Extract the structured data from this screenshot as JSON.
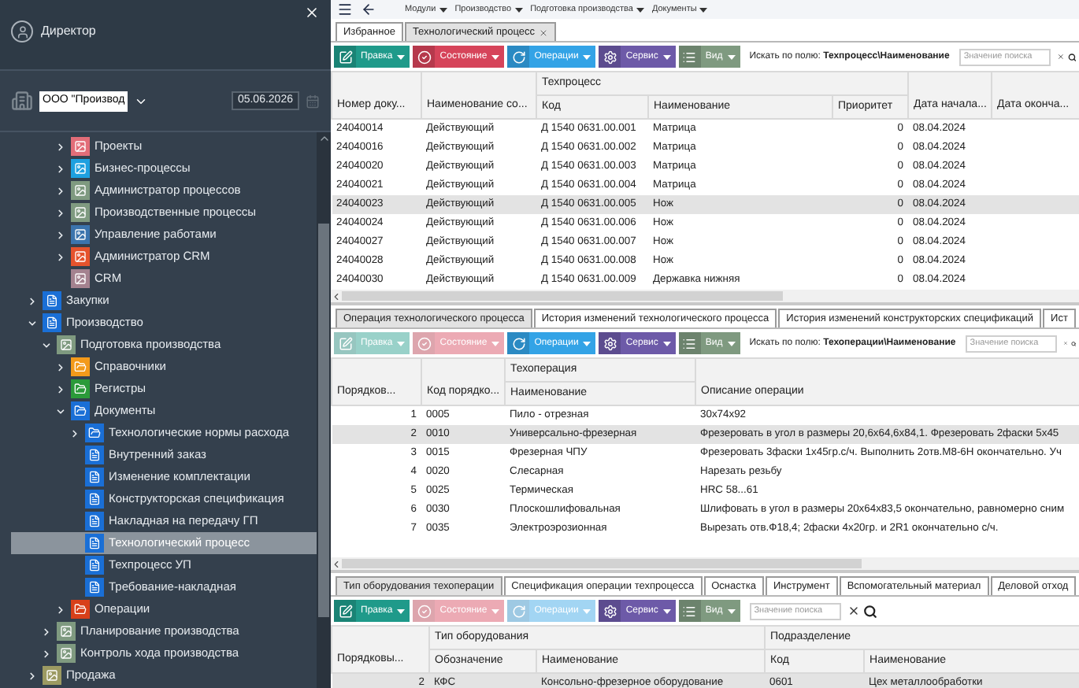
{
  "sidebar": {
    "user": "Директор",
    "organization": "ООО \"Производ",
    "date": "05.06.2026",
    "tree": [
      {
        "children": [
          {
            "children": [
              {
                "label": "Проекты",
                "kind": "module",
                "color": "#e26d78",
                "expanded": false,
                "selected": false
              },
              {
                "label": "Бизнес-процессы",
                "kind": "module",
                "color": "#1ea0e0",
                "expanded": false,
                "selected": false
              },
              {
                "label": "Администратор процессов",
                "kind": "module",
                "color": "#7f9a80",
                "expanded": false,
                "selected": false
              },
              {
                "label": "Производственные процессы",
                "kind": "module",
                "color": "#7f9a80",
                "expanded": false,
                "selected": false
              },
              {
                "label": "Управление работами",
                "kind": "module",
                "color": "#3b74ad",
                "expanded": false,
                "selected": false
              },
              {
                "label": "Администратор CRM",
                "kind": "module",
                "color": "#e5532d",
                "expanded": false,
                "selected": false
              },
              {
                "label": "CRM",
                "kind": "module",
                "color": "#a4828f",
                "selected": false
              }
            ]
          }
        ]
      },
      {
        "label": "Закупки",
        "kind": "document",
        "color": "#1a6fd6",
        "expanded": false,
        "selected": false
      },
      {
        "label": "Производство",
        "kind": "document",
        "color": "#1a6fd6",
        "expanded": true,
        "selected": false,
        "children": [
          {
            "label": "Подготовка производства",
            "kind": "module",
            "color": "#7f9a80",
            "expanded": true,
            "selected": false,
            "children": [
              {
                "label": "Справочники",
                "kind": "folder",
                "color": "#f39a1a",
                "expanded": false,
                "selected": false
              },
              {
                "label": "Регистры",
                "kind": "folder",
                "color": "#2b9a3a",
                "expanded": false,
                "selected": false
              },
              {
                "label": "Документы",
                "kind": "folder",
                "color": "#1a6fd6",
                "expanded": true,
                "selected": false,
                "children": [
                  {
                    "label": "Технологические нормы расхода",
                    "kind": "folder",
                    "color": "#1a6fd6",
                    "expanded": false,
                    "selected": false
                  },
                  {
                    "label": "Внутренний заказ",
                    "kind": "document",
                    "color": "#1a6fd6",
                    "selected": false
                  },
                  {
                    "label": "Изменение комплектации",
                    "kind": "document",
                    "color": "#1a6fd6",
                    "selected": false
                  },
                  {
                    "label": "Конструкторская спецификация",
                    "kind": "document",
                    "color": "#1a6fd6",
                    "selected": false
                  },
                  {
                    "label": "Накладная на передачу ГП",
                    "kind": "document",
                    "color": "#1a6fd6",
                    "selected": false
                  },
                  {
                    "label": "Технологический процесс",
                    "kind": "document",
                    "color": "#1a6fd6",
                    "selected": true
                  },
                  {
                    "label": "Техпроцесс УП",
                    "kind": "document",
                    "color": "#1a6fd6",
                    "selected": false
                  },
                  {
                    "label": "Требование-накладная",
                    "kind": "document",
                    "color": "#1a6fd6",
                    "selected": false
                  }
                ]
              },
              {
                "label": "Операции",
                "kind": "folder",
                "color": "#d8401a",
                "expanded": false,
                "selected": false
              }
            ]
          },
          {
            "label": "Планирование производства",
            "kind": "module",
            "color": "#7f9a80",
            "expanded": false,
            "selected": false
          },
          {
            "label": "Контроль хода производства",
            "kind": "module",
            "color": "#7f9a80",
            "expanded": false,
            "selected": false
          }
        ]
      },
      {
        "label": "Продажа",
        "kind": "module",
        "color": "#9c9a62",
        "expanded": false,
        "selected": false
      }
    ]
  },
  "top_bar": {
    "breadcrumbs": [
      "Модули",
      "Производство",
      "Подготовка производства",
      "Документы"
    ]
  },
  "panels": [
    {
      "tabs": [
        {
          "label": "Избранное",
          "selected": false,
          "closable": false
        },
        {
          "label": "Технологический процесс",
          "selected": true,
          "closable": true
        }
      ],
      "toolbar": {
        "buttons": [
          {
            "label": "Правка",
            "kind": "edit",
            "disabled": false
          },
          {
            "label": "Состояние",
            "kind": "state",
            "disabled": false
          },
          {
            "label": "Операции",
            "kind": "operations",
            "disabled": false
          },
          {
            "label": "Сервис",
            "kind": "service",
            "disabled": false
          },
          {
            "label": "Вид",
            "kind": "view",
            "disabled": false
          }
        ],
        "search_label": "Искать по полю: **Техпроцесс\\Наименование**",
        "search_placeholder": "Значение поиска"
      },
      "table": {
        "columns": [
          {
            "label": "Номер доку..."
          },
          {
            "label": "Наименование со..."
          },
          {
            "label": "Техпроцесс",
            "colspan": 3,
            "children": [
              {
                "label": "Код"
              },
              {
                "label": "Наименование"
              },
              {
                "label": "Приоритет"
              }
            ]
          },
          {
            "label": "Дата начала..."
          },
          {
            "label": "Дата оконча..."
          }
        ],
        "rows": [
          {
            "cells": [
              "24040014",
              "Действующий",
              "Д 1540 0631.00.001",
              "Матрица",
              "0",
              "08.04.2024"
            ],
            "selected": false
          },
          {
            "cells": [
              "24040016",
              "Действующий",
              "Д 1540 0631.00.002",
              "Матрица",
              "0",
              "08.04.2024"
            ],
            "selected": false
          },
          {
            "cells": [
              "24040020",
              "Действующий",
              "Д 1540 0631.00.003",
              "Матрица",
              "0",
              "08.04.2024"
            ],
            "selected": false
          },
          {
            "cells": [
              "24040021",
              "Действующий",
              "Д 1540 0631.00.004",
              "Матрица",
              "0",
              "08.04.2024"
            ],
            "selected": false
          },
          {
            "cells": [
              "24040023",
              "Действующий",
              "Д 1540 0631.00.005",
              "Нож",
              "0",
              "08.04.2024"
            ],
            "selected": true
          },
          {
            "cells": [
              "24040024",
              "Действующий",
              "Д 1540 0631.00.006",
              "Нож",
              "0",
              "08.04.2024"
            ],
            "selected": false
          },
          {
            "cells": [
              "24040027",
              "Действующий",
              "Д 1540 0631.00.007",
              "Нож",
              "0",
              "08.04.2024"
            ],
            "selected": false
          },
          {
            "cells": [
              "24040028",
              "Действующий",
              "Д 1540 0631.00.008",
              "Нож",
              "0",
              "08.04.2024"
            ],
            "selected": false
          },
          {
            "cells": [
              "24040030",
              "Действующий",
              "Д 1540 0631.00.009",
              "Державка нижняя",
              "0",
              "08.04.2024"
            ],
            "selected": false
          }
        ]
      }
    },
    {
      "tabs": [
        {
          "label": "Операция технологического процесса",
          "selected": true,
          "closable": false
        },
        {
          "label": "История изменений технологического процесса",
          "selected": false,
          "closable": false
        },
        {
          "label": "История изменений конструкторских спецификаций",
          "selected": false,
          "closable": false
        },
        {
          "label": "Ист",
          "selected": false,
          "closable": false
        }
      ],
      "toolbar": {
        "buttons": [
          {
            "label": "Правка",
            "kind": "edit",
            "disabled": true
          },
          {
            "label": "Состояние",
            "kind": "state",
            "disabled": true
          },
          {
            "label": "Операции",
            "kind": "operations",
            "disabled": false
          },
          {
            "label": "Сервис",
            "kind": "service",
            "disabled": false
          },
          {
            "label": "Вид",
            "kind": "view",
            "disabled": false
          }
        ],
        "search_label": "Искать по полю: **Техоперации\\Наименование**",
        "search_placeholder": "Значение поиска"
      },
      "table": {
        "columns": [
          {
            "label": "Порядков..."
          },
          {
            "label": "Код порядко..."
          },
          {
            "label": "Техоперация",
            "children": [
              {
                "label": "Наименование"
              }
            ]
          },
          {
            "label": "Описание операции"
          }
        ],
        "rows": [
          {
            "cells": [
              "1",
              "0005",
              "Пило - отрезная",
              "30х74х92"
            ],
            "selected": false
          },
          {
            "cells": [
              "2",
              "0010",
              "Универсально-фрезерная",
              "Фрезеровать в угол в размеры 20,6х64,6х84,1. Фрезеровать 2фаски 5х45"
            ],
            "selected": true
          },
          {
            "cells": [
              "3",
              "0015",
              "Фрезерная ЧПУ",
              "Фрезеровать 3фаски 1х45гр.с/ч. Выполнить 2отв.М8-6Н окончательно. Уч"
            ],
            "selected": false
          },
          {
            "cells": [
              "4",
              "0020",
              "Слесарная",
              "Нарезать резьбу"
            ],
            "selected": false
          },
          {
            "cells": [
              "5",
              "0025",
              "Термическая",
              "HRC 58...61"
            ],
            "selected": false
          },
          {
            "cells": [
              "6",
              "0030",
              "Плоскошлифовальная",
              "Шлифовать в угол в размеры 20х64х83,5 окончательно, равномерно сним"
            ],
            "selected": false
          },
          {
            "cells": [
              "7",
              "0035",
              "Электроэрозионная",
              "Вырезать отв.Ф18,4; 2фаски 4х20гр. и 2R1 окончательно с/ч."
            ],
            "selected": false
          }
        ]
      }
    },
    {
      "tabs": [
        {
          "label": "Тип оборудования техоперации",
          "selected": true,
          "closable": false
        },
        {
          "label": "Спецификация операции техпроцесса",
          "selected": false,
          "closable": false
        },
        {
          "label": "Оснастка",
          "selected": false,
          "closable": false
        },
        {
          "label": "Инструмент",
          "selected": false,
          "closable": false
        },
        {
          "label": "Вспомогательный материал",
          "selected": false,
          "closable": false
        },
        {
          "label": "Деловой отход",
          "selected": false,
          "closable": false
        }
      ],
      "toolbar": {
        "buttons": [
          {
            "label": "Правка",
            "kind": "edit",
            "disabled": false
          },
          {
            "label": "Состояние",
            "kind": "state",
            "disabled": true
          },
          {
            "label": "Операции",
            "kind": "operations",
            "disabled": true
          },
          {
            "label": "Сервис",
            "kind": "service",
            "disabled": false
          },
          {
            "label": "Вид",
            "kind": "view",
            "disabled": false
          }
        ],
        "search_placeholder": "Значение поиска"
      },
      "table": {
        "columns": [
          {
            "label": "Порядковы..."
          },
          {
            "label": "Тип оборудования",
            "colspan": 2,
            "children": [
              {
                "label": "Обозначение"
              },
              {
                "label": "Наименование"
              }
            ]
          },
          {
            "label": "Подразделение",
            "colspan": 2,
            "children": [
              {
                "label": "Код"
              },
              {
                "label": "Наименование"
              }
            ]
          }
        ],
        "rows": [
          {
            "cells": [
              "2",
              "КФС",
              "Консольно-фрезерное оборудование",
              "0601",
              "Цех металлообработки"
            ],
            "selected": true
          }
        ]
      }
    }
  ]
}
